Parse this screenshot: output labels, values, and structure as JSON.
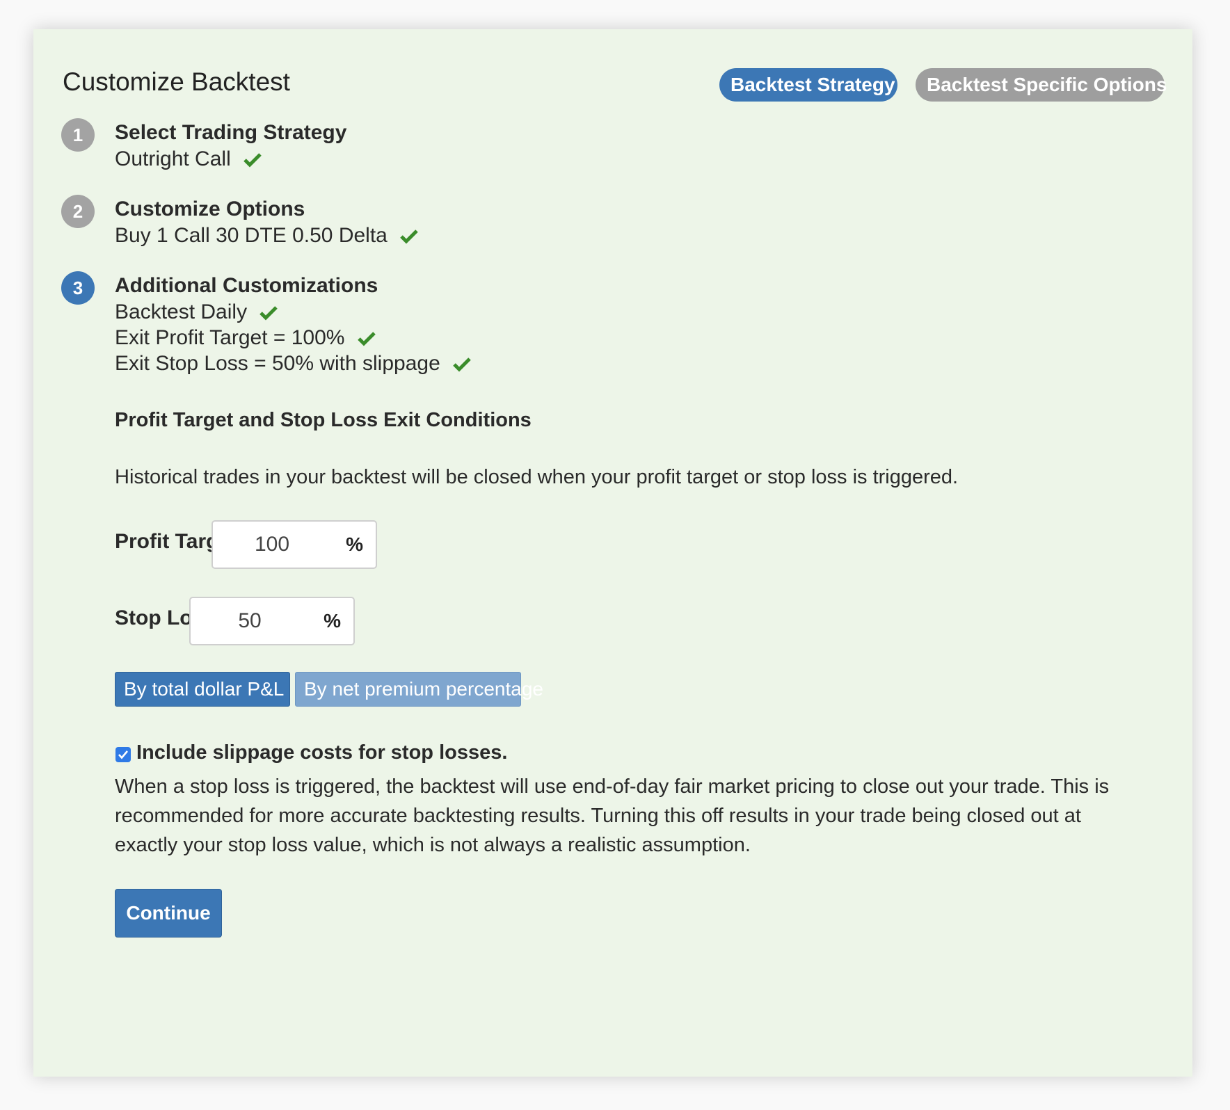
{
  "header": {
    "title": "Customize Backtest",
    "pills": {
      "strategy": "Backtest Strategy",
      "options": "Backtest Specific Options"
    }
  },
  "steps": [
    {
      "number": "1",
      "title": "Select Trading Strategy",
      "lines": [
        "Outright Call"
      ]
    },
    {
      "number": "2",
      "title": "Customize Options",
      "lines": [
        "Buy 1 Call 30 DTE 0.50 Delta"
      ]
    },
    {
      "number": "3",
      "title": "Additional Customizations",
      "lines": [
        "Backtest Daily",
        "Exit Profit Target = 100%",
        "Exit Stop Loss = 50% with slippage"
      ]
    }
  ],
  "exit_conditions": {
    "heading": "Profit Target and Stop Loss Exit Conditions",
    "description": "Historical trades in your backtest will be closed when your profit target or stop loss is triggered.",
    "profit_target": {
      "label": "Profit Target",
      "value": "100",
      "unit": "%"
    },
    "stop_loss": {
      "label": "Stop Loss",
      "value": "50",
      "unit": "%"
    },
    "mode_buttons": {
      "active": "By total dollar P&L",
      "inactive": "By net premium percentage"
    },
    "slippage": {
      "checked": true,
      "label": "Include slippage costs for stop losses.",
      "description": "When a stop loss is triggered, the backtest will use end-of-day fair market pricing to close out your trade. This is recommended for more accurate backtesting results. Turning this off results in your trade being closed out at exactly your stop loss value, which is not always a realistic assumption."
    }
  },
  "actions": {
    "continue": "Continue"
  },
  "colors": {
    "card_bg": "#edf5e8",
    "primary": "#3c77b5",
    "muted": "#a3a3a3",
    "check": "#3a8c2a"
  }
}
